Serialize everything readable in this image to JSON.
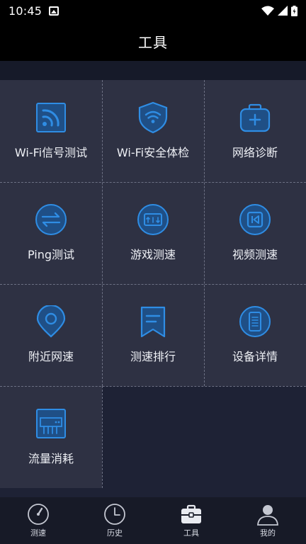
{
  "status_bar": {
    "time": "10:45"
  },
  "header": {
    "title": "工具"
  },
  "tools": [
    {
      "label": "Wi-Fi信号测试",
      "icon": "wifi-signal-icon"
    },
    {
      "label": "Wi-Fi安全体检",
      "icon": "wifi-shield-icon"
    },
    {
      "label": "网络诊断",
      "icon": "medical-kit-icon"
    },
    {
      "label": "Ping测试",
      "icon": "ping-arrows-icon"
    },
    {
      "label": "游戏测速",
      "icon": "game-speed-icon"
    },
    {
      "label": "视频测速",
      "icon": "video-play-icon"
    },
    {
      "label": "附近网速",
      "icon": "location-pin-icon"
    },
    {
      "label": "测速排行",
      "icon": "ranking-bookmark-icon"
    },
    {
      "label": "设备详情",
      "icon": "phone-device-icon"
    },
    {
      "label": "流量消耗",
      "icon": "data-usage-icon"
    }
  ],
  "bottom_nav": [
    {
      "label": "测速",
      "icon": "speedometer-icon",
      "active": false
    },
    {
      "label": "历史",
      "icon": "clock-icon",
      "active": false
    },
    {
      "label": "工具",
      "icon": "toolbox-icon",
      "active": true
    },
    {
      "label": "我的",
      "icon": "user-icon",
      "active": false
    }
  ],
  "colors": {
    "accent": "#2f8de4",
    "tile_bg": "#2e3143",
    "page_bg": "#1e2235"
  }
}
